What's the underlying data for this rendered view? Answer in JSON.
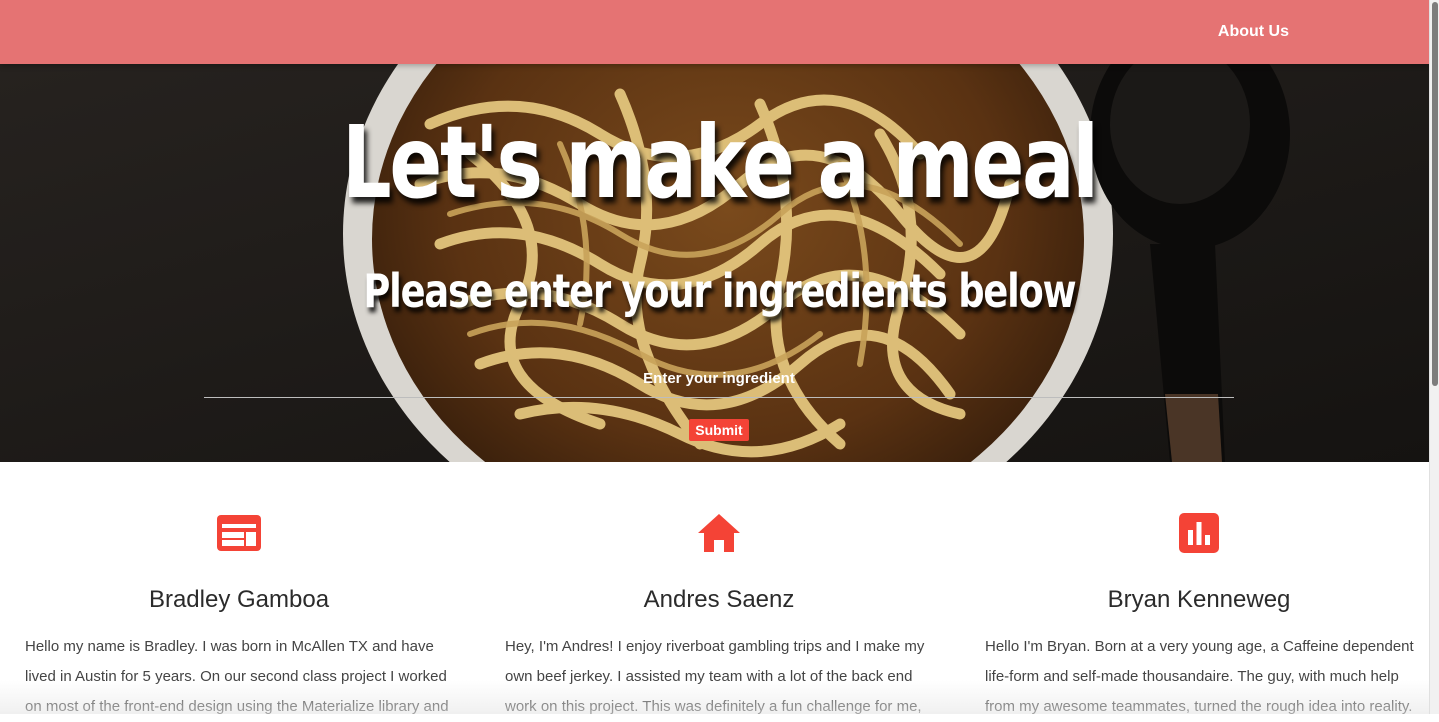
{
  "navbar": {
    "about_label": "About Us",
    "color": "#e57373"
  },
  "hero": {
    "title": "Let's make a meal",
    "subtitle": "Please enter your ingredients below",
    "input_placeholder": "Enter your ingredient",
    "input_value": "",
    "submit_label": "Submit",
    "accent": "#f44336"
  },
  "team": [
    {
      "icon": "web-icon",
      "name": "Bradley Gamboa",
      "bio": "Hello my name is Bradley. I was born in McAllen TX and have lived in Austin for 5 years. On our second class project I worked on most of the front-end design using the Materialize library and"
    },
    {
      "icon": "home-icon",
      "name": "Andres Saenz",
      "bio": "Hey, I'm Andres! I enjoy riverboat gambling trips and I make my own beef jerkey. I assisted my team with a lot of the back end work on this project. This was definitely a fun challenge for me,"
    },
    {
      "icon": "bar-chart-icon",
      "name": "Bryan Kenneweg",
      "bio": "Hello I'm Bryan. Born at a very young age, a Caffeine dependent life-form and self-made thousandaire. The guy, with much help from my awesome teammates, turned the rough idea into reality."
    }
  ]
}
